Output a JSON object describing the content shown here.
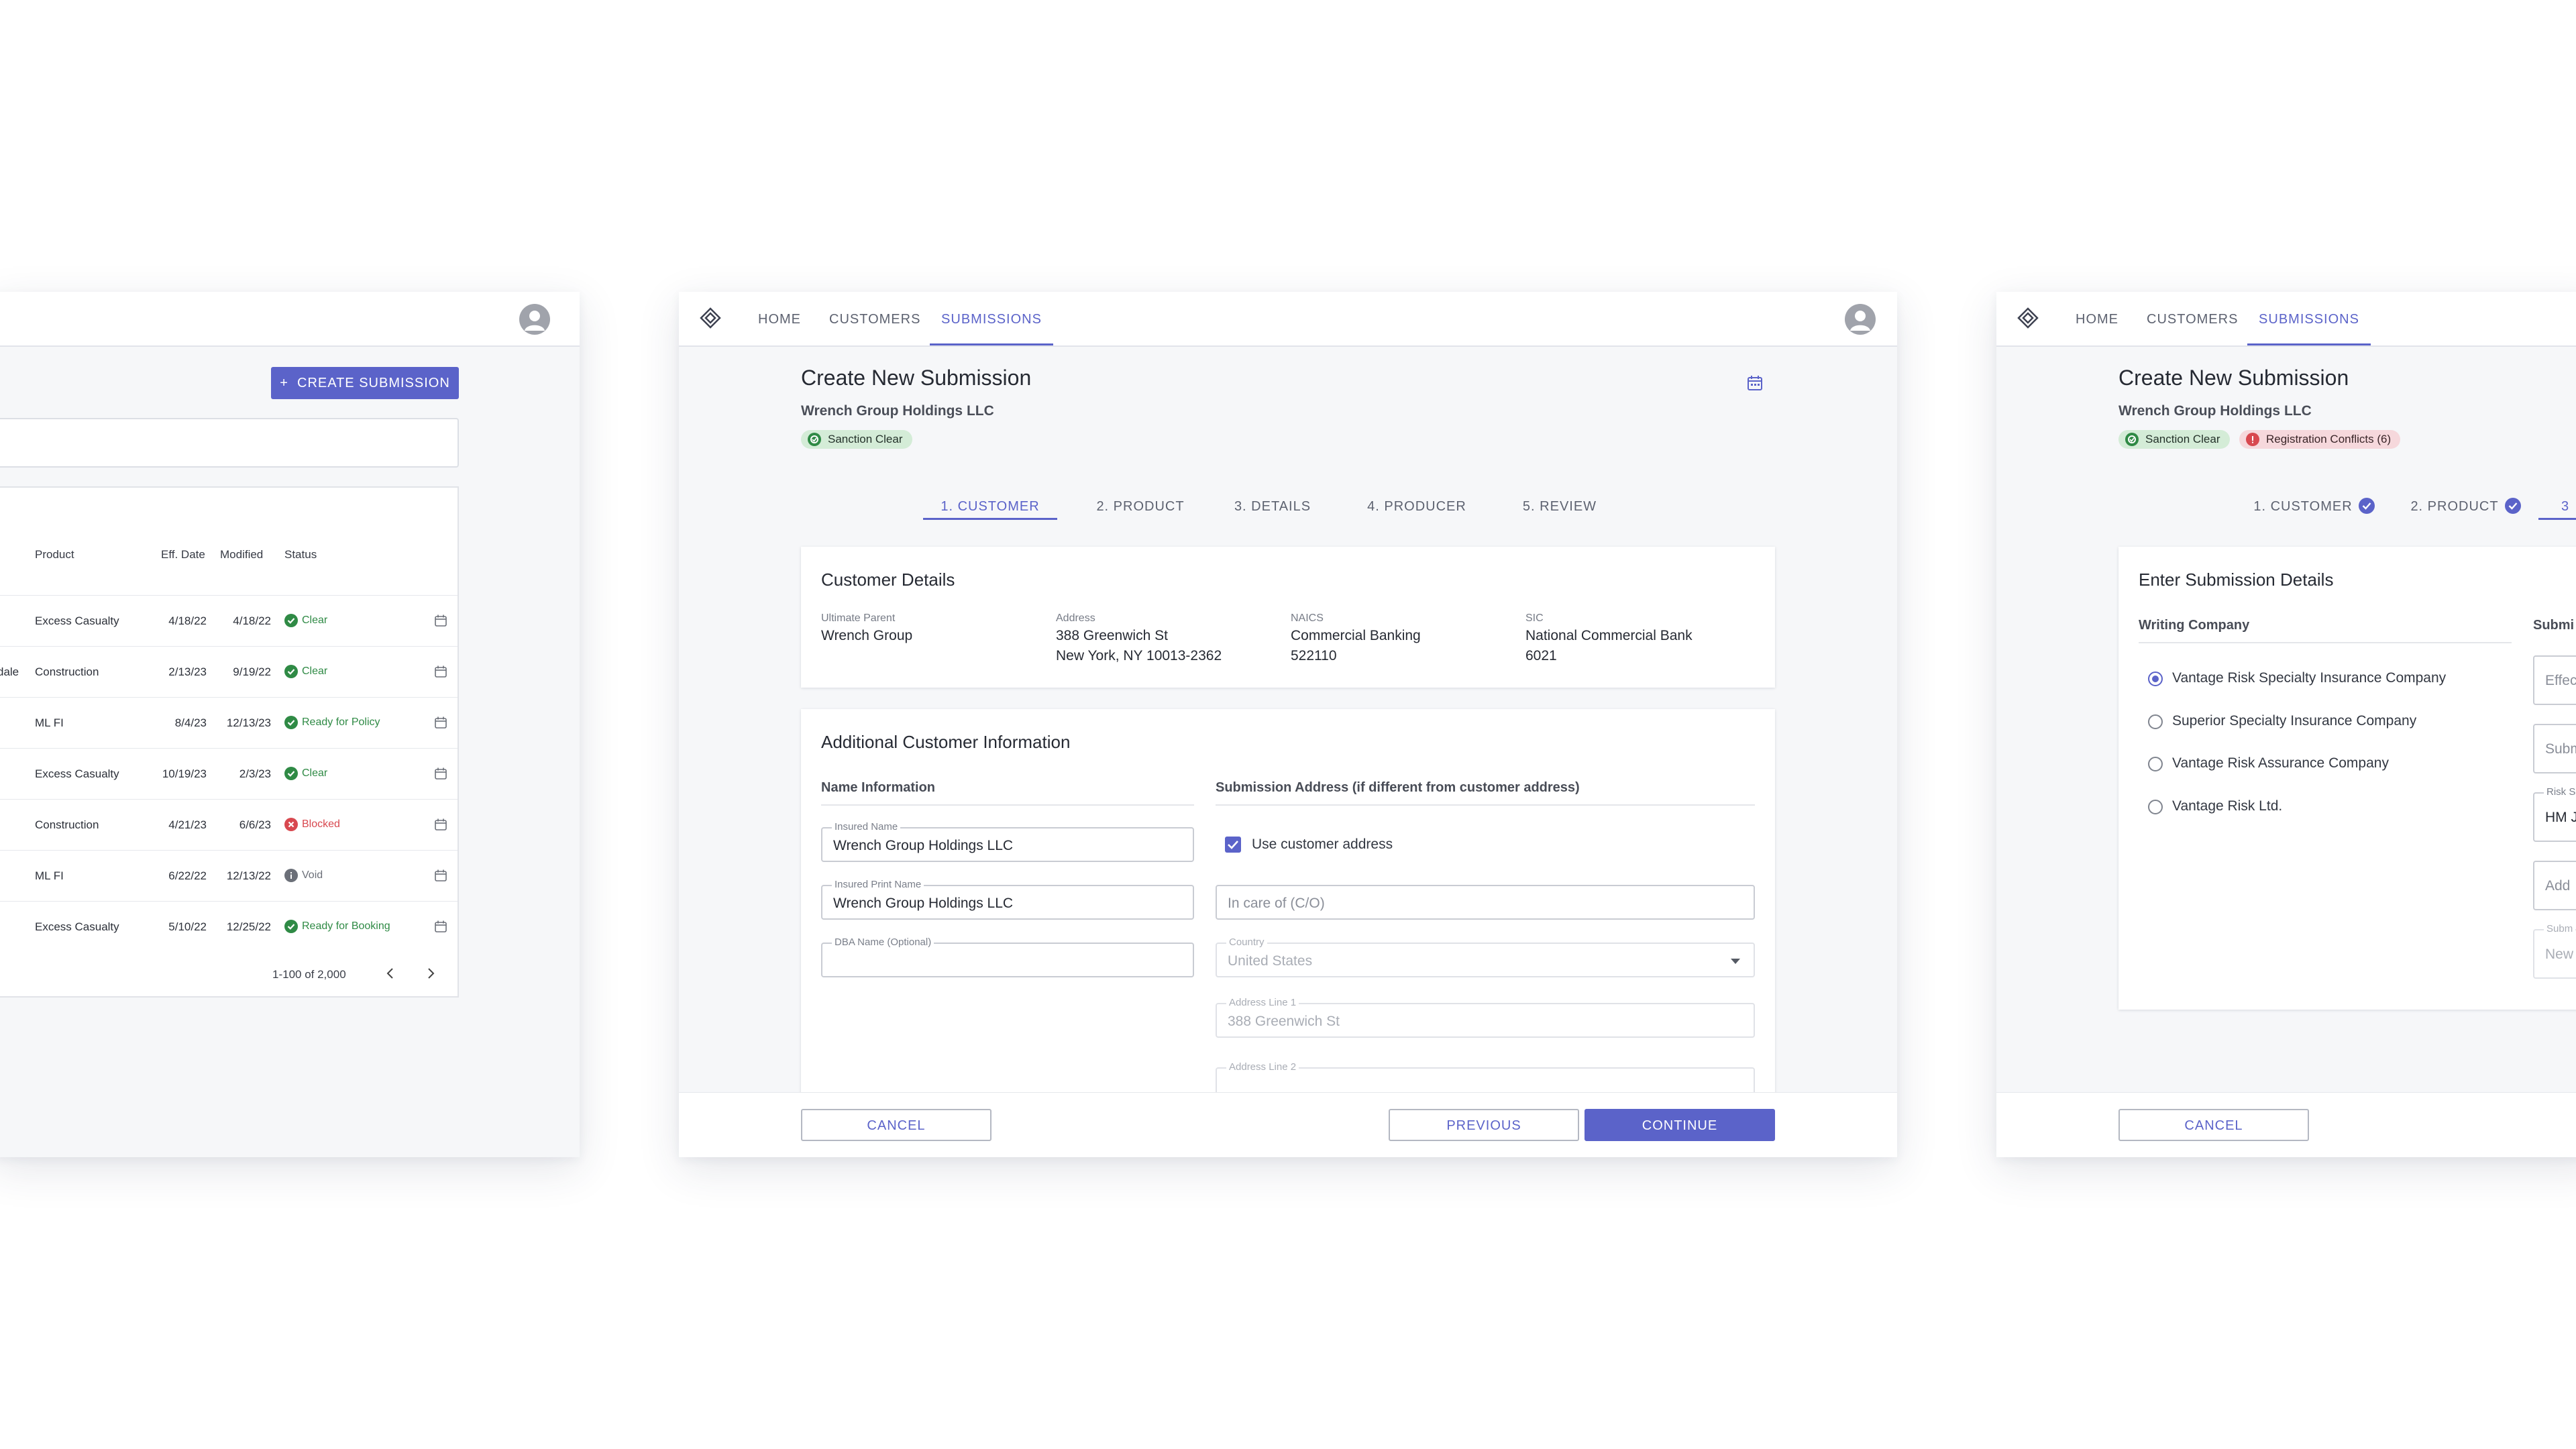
{
  "nav": {
    "home": "HOME",
    "customers": "CUSTOMERS",
    "submissions": "SUBMISSIONS"
  },
  "list_window": {
    "create_label": "CREATE SUBMISSION",
    "columns": {
      "product": "Product",
      "eff_date": "Eff. Date",
      "modified": "Modified",
      "status": "Status"
    },
    "rows": [
      {
        "prefix": "",
        "product": "Excess Casualty",
        "eff": "4/18/22",
        "mod": "4/18/22",
        "status": "Clear",
        "kind": "clear"
      },
      {
        "prefix": "dale",
        "product": "Construction",
        "eff": "2/13/23",
        "mod": "9/19/22",
        "status": "Clear",
        "kind": "clear"
      },
      {
        "prefix": "",
        "product": "ML FI",
        "eff": "8/4/23",
        "mod": "12/13/23",
        "status": "Ready for Policy",
        "kind": "clear"
      },
      {
        "prefix": "",
        "product": "Excess Casualty",
        "eff": "10/19/23",
        "mod": "2/3/23",
        "status": "Clear",
        "kind": "clear"
      },
      {
        "prefix": "",
        "product": "Construction",
        "eff": "4/21/23",
        "mod": "6/6/23",
        "status": "Blocked",
        "kind": "blocked"
      },
      {
        "prefix": "",
        "product": "ML FI",
        "eff": "6/22/22",
        "mod": "12/13/22",
        "status": "Void",
        "kind": "void"
      },
      {
        "prefix": "",
        "product": "Excess Casualty",
        "eff": "5/10/22",
        "mod": "12/25/22",
        "status": "Ready for Booking",
        "kind": "clear"
      }
    ],
    "pagination": "1-100 of 2,000"
  },
  "submission": {
    "title": "Create New Submission",
    "company": "Wrench Group Holdings LLC",
    "sanction_chip": "Sanction Clear",
    "conflict_chip": "Registration Conflicts (6)",
    "steps": [
      "1. CUSTOMER",
      "2. PRODUCT",
      "3. DETAILS",
      "4. PRODUCER",
      "5. REVIEW"
    ],
    "customer_details": {
      "title": "Customer Details",
      "ultimate_parent_label": "Ultimate Parent",
      "ultimate_parent": "Wrench Group",
      "address_label": "Address",
      "address_line1": "388 Greenwich St",
      "address_line2": "New York, NY 10013-2362",
      "naics_label": "NAICS",
      "naics_name": "Commercial Banking",
      "naics_code": "522110",
      "sic_label": "SIC",
      "sic_name": "National Commercial Bank",
      "sic_code": "6021"
    },
    "additional": {
      "title": "Additional Customer Information",
      "name_section": "Name Information",
      "address_section": "Submission Address (if different from customer address)",
      "insured_name_label": "Insured Name",
      "insured_name": "Wrench Group Holdings LLC",
      "insured_print_label": "Insured Print Name",
      "insured_print": "Wrench Group Holdings LLC",
      "dba_label": "DBA Name (Optional)",
      "use_customer_address": "Use customer address",
      "in_care_of_placeholder": "In care of (C/O)",
      "country_label": "Country",
      "country": "United States",
      "address1_label": "Address Line 1",
      "address1": "388 Greenwich St",
      "address2_label": "Address Line 2"
    },
    "buttons": {
      "cancel": "CANCEL",
      "previous": "PREVIOUS",
      "continue": "CONTINUE"
    }
  },
  "details_window": {
    "card_title": "Enter Submission Details",
    "writing_company_label": "Writing Company",
    "submission_col_label": "Submi",
    "companies": [
      "Vantage Risk Specialty Insurance Company",
      "Superior Specialty Insurance Company",
      "Vantage Risk Assurance Company",
      "Vantage Risk Ltd."
    ],
    "partial_fields": {
      "effective": "Effec",
      "submission": "Subm",
      "risk_label": "Risk S",
      "risk_value": "HM J",
      "add": "Add",
      "sub_label": "Subm",
      "new": "New"
    },
    "step3_partial": "3"
  },
  "colors": {
    "accent": "#5b63c9",
    "green": "#2f8a45",
    "red": "#d8484f",
    "void": "#6b6f78"
  }
}
